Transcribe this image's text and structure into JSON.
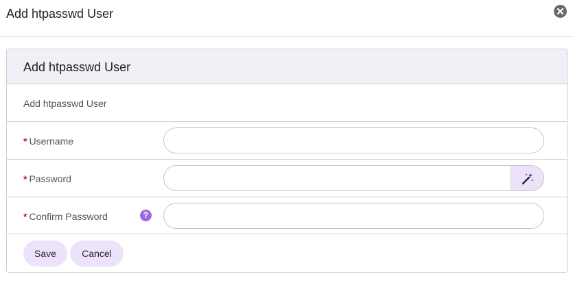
{
  "dialog": {
    "title": "Add htpasswd User"
  },
  "panel": {
    "title": "Add htpasswd User",
    "description": "Add htpasswd User"
  },
  "fields": {
    "required_marker": "*",
    "username": {
      "label": "Username",
      "value": ""
    },
    "password": {
      "label": "Password",
      "value": ""
    },
    "confirm_password": {
      "label": "Confirm Password",
      "value": "",
      "help_glyph": "?"
    }
  },
  "actions": {
    "save_label": "Save",
    "cancel_label": "Cancel"
  },
  "colors": {
    "accent": "#9b6be0",
    "button_bg": "#ece3fa",
    "panel_header_bg": "#f3eff7",
    "required": "#c51f1f"
  },
  "icons": {
    "close": "close-icon",
    "generate": "magic-wand-icon",
    "help": "help-icon"
  }
}
